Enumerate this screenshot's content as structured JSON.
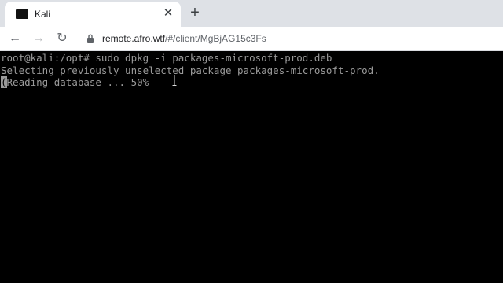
{
  "tab": {
    "title": "Kali",
    "close_glyph": "✕",
    "new_tab_glyph": "+"
  },
  "toolbar": {
    "back_glyph": "←",
    "forward_glyph": "→",
    "reload_glyph": "↻",
    "url_host": "remote.afro.wtf",
    "url_path": "/#/client/MgBjAG15c3Fs"
  },
  "terminal": {
    "lines": [
      "root@kali:/opt# sudo dpkg -i packages-microsoft-prod.deb",
      "Selecting previously unselected package packages-microsoft-prod."
    ],
    "cursor_char": "(",
    "current_line_rest": "Reading database ... 50%"
  },
  "icons": {
    "favicon": "terminal-icon",
    "lock": "lock-icon",
    "mouse_cursor": "text-cursor-icon"
  }
}
